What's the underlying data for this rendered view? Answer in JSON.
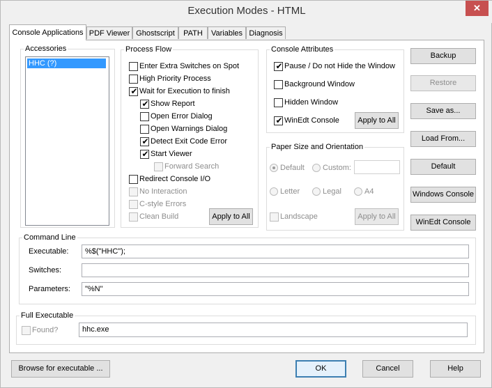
{
  "window": {
    "title": "Execution Modes - HTML",
    "close_glyph": "✕"
  },
  "tabs": [
    {
      "label": "Console Applications",
      "active": true
    },
    {
      "label": "PDF Viewer"
    },
    {
      "label": "Ghostscript"
    },
    {
      "label": "PATH"
    },
    {
      "label": "Variables"
    },
    {
      "label": "Diagnosis"
    }
  ],
  "accessories": {
    "legend": "Accessories",
    "items": [
      "HHC  (?)"
    ]
  },
  "process_flow": {
    "legend": "Process Flow",
    "options": [
      {
        "label": "Enter Extra Switches on Spot",
        "checked": false,
        "enabled": true
      },
      {
        "label": "High Priority Process",
        "checked": false,
        "enabled": true
      },
      {
        "label": "Wait for Execution to finish",
        "checked": true,
        "enabled": true
      },
      {
        "label": "Show Report",
        "checked": true,
        "enabled": true
      },
      {
        "label": "Open Error Dialog",
        "checked": false,
        "enabled": true
      },
      {
        "label": "Open Warnings Dialog",
        "checked": false,
        "enabled": true
      },
      {
        "label": "Detect Exit Code Error",
        "checked": true,
        "enabled": true
      },
      {
        "label": "Start Viewer",
        "checked": true,
        "enabled": true
      },
      {
        "label": "Forward Search",
        "checked": false,
        "enabled": false
      },
      {
        "label": "Redirect Console I/O",
        "checked": false,
        "enabled": true
      },
      {
        "label": "No Interaction",
        "checked": false,
        "enabled": false
      },
      {
        "label": "C-style Errors",
        "checked": false,
        "enabled": false
      },
      {
        "label": "Clean Build",
        "checked": false,
        "enabled": false
      }
    ],
    "apply_label": "Apply to All"
  },
  "console_attributes": {
    "legend": "Console Attributes",
    "options": [
      {
        "label": "Pause / Do not Hide the Window",
        "checked": true
      },
      {
        "label": "Background Window",
        "checked": false
      },
      {
        "label": "Hidden Window",
        "checked": false
      },
      {
        "label": "WinEdt Console",
        "checked": true
      }
    ],
    "apply_label": "Apply to All"
  },
  "paper": {
    "legend": "Paper Size and Orientation",
    "default_label": "Default",
    "custom_label": "Custom:",
    "letter_label": "Letter",
    "legal_label": "Legal",
    "a4_label": "A4",
    "landscape_label": "Landscape",
    "apply_label": "Apply to All",
    "custom_value": ""
  },
  "side_buttons": {
    "backup": "Backup",
    "restore": "Restore",
    "save_as": "Save as...",
    "load_from": "Load From...",
    "default": "Default",
    "windows_console": "Windows Console",
    "winedt_console": "WinEdt Console"
  },
  "command_line": {
    "legend": "Command Line",
    "executable_label": "Executable:",
    "executable_value": "%$(\"HHC\");",
    "switches_label": "Switches:",
    "switches_value": "",
    "parameters_label": "Parameters:",
    "parameters_value": "\"%N\""
  },
  "full_executable": {
    "legend": "Full Executable",
    "found_label": "Found?",
    "value": "hhc.exe"
  },
  "footer": {
    "browse": "Browse for executable ...",
    "ok": "OK",
    "cancel": "Cancel",
    "help": "Help"
  }
}
